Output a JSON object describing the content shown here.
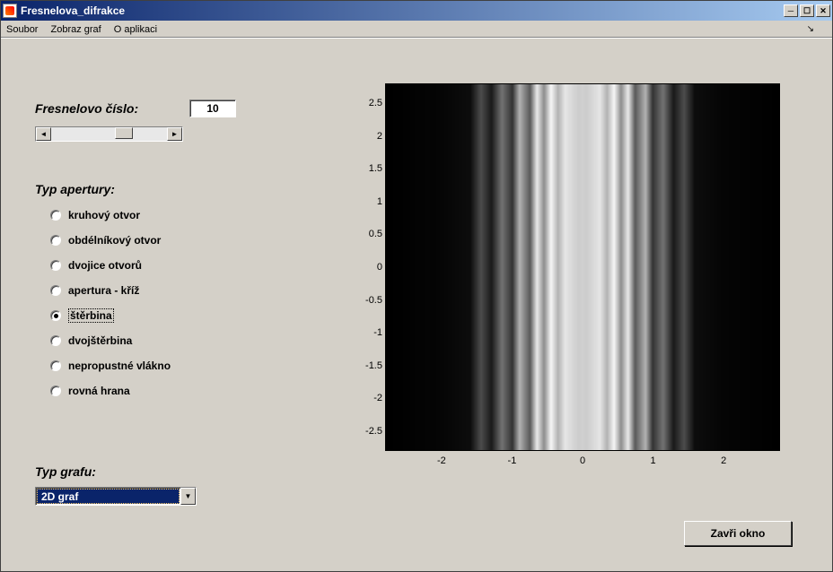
{
  "window": {
    "title": "Fresnelova_difrakce"
  },
  "menubar": {
    "items": [
      "Soubor",
      "Zobraz graf",
      "O aplikaci"
    ]
  },
  "controls": {
    "fresnel_label": "Fresnelovo číslo:",
    "fresnel_value": "10",
    "aperture_label": "Typ apertury:",
    "aperture_options": [
      {
        "label": "kruhový otvor",
        "checked": false
      },
      {
        "label": "obdélníkový otvor",
        "checked": false
      },
      {
        "label": "dvojice otvorů",
        "checked": false
      },
      {
        "label": "apertura - kříž",
        "checked": false
      },
      {
        "label": "štěrbina",
        "checked": true
      },
      {
        "label": "dvojštěrbina",
        "checked": false
      },
      {
        "label": "nepropustné vlákno",
        "checked": false
      },
      {
        "label": "rovná hrana",
        "checked": false
      }
    ],
    "graphtype_label": "Typ grafu:",
    "graphtype_selected": "2D graf",
    "close_button": "Zavři okno"
  },
  "chart_data": {
    "type": "heatmap",
    "title": "",
    "xlabel": "",
    "ylabel": "",
    "xlim": [
      -2.8,
      2.8
    ],
    "ylim": [
      -2.8,
      2.8
    ],
    "x_ticks": [
      -2,
      -1,
      0,
      1,
      2
    ],
    "y_ticks": [
      -2.5,
      -2,
      -1.5,
      -1,
      -0.5,
      0,
      0.5,
      1,
      1.5,
      2,
      2.5
    ],
    "description": "Fresnel slit diffraction intensity pattern, vertical fringes invariant along y. Central bright band with oscillatory fringes, decaying to black at |x|>~1.6.",
    "intensity_profile_x": {
      "x": [
        -2.8,
        -2.0,
        -1.6,
        -1.45,
        -1.3,
        -1.15,
        -1.0,
        -0.9,
        -0.75,
        -0.65,
        -0.55,
        -0.45,
        -0.35,
        -0.25,
        -0.15,
        -0.05,
        0.0,
        0.05,
        0.15,
        0.25,
        0.35,
        0.45,
        0.55,
        0.65,
        0.75,
        0.9,
        1.0,
        1.15,
        1.3,
        1.45,
        1.6,
        2.0,
        2.8
      ],
      "intensity": [
        0.0,
        0.02,
        0.05,
        0.3,
        0.1,
        0.45,
        0.2,
        0.7,
        0.35,
        0.92,
        0.55,
        0.97,
        0.7,
        0.9,
        0.85,
        0.8,
        0.82,
        0.8,
        0.85,
        0.9,
        0.7,
        0.97,
        0.55,
        0.92,
        0.35,
        0.7,
        0.2,
        0.45,
        0.1,
        0.3,
        0.05,
        0.02,
        0.0
      ]
    }
  }
}
